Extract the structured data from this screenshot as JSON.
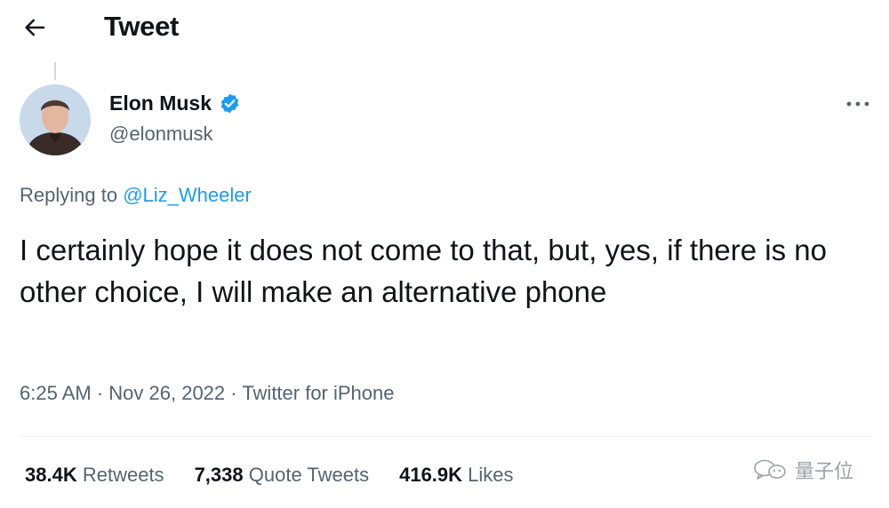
{
  "header": {
    "title": "Tweet",
    "back_icon": "arrow-left-icon"
  },
  "author": {
    "name": "Elon Musk",
    "handle": "@elonmusk",
    "verified": true,
    "verified_color": "#1d9bf0"
  },
  "reply": {
    "prefix": "Replying to ",
    "mention": "@Liz_Wheeler"
  },
  "tweet": {
    "text": "I certainly hope it does not come to that, but, yes, if there is no other choice, I will make an alternative phone"
  },
  "meta": {
    "time": "6:25 AM",
    "separator": " · ",
    "date": "Nov 26, 2022",
    "source": "Twitter for iPhone"
  },
  "stats": {
    "retweets_count": "38.4K",
    "retweets_label": "Retweets",
    "quotes_count": "7,338",
    "quotes_label": "Quote Tweets",
    "likes_count": "416.9K",
    "likes_label": "Likes"
  },
  "watermark": {
    "text": "量子位"
  },
  "colors": {
    "text": "#0f1419",
    "secondary": "#536471",
    "accent": "#1d9bf0",
    "divider": "#eff3f4"
  }
}
